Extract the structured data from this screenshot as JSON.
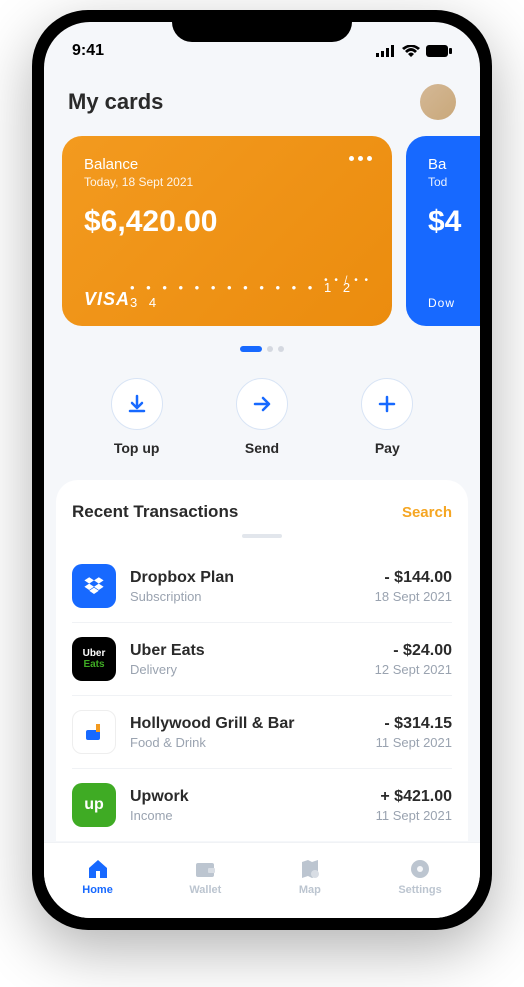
{
  "status": {
    "time": "9:41"
  },
  "header": {
    "title": "My cards"
  },
  "cards": [
    {
      "label": "Balance",
      "date": "Today, 18 Sept 2021",
      "balance": "$6,420.00",
      "brand": "VISA",
      "number": "• • • •   • • • •   • • • •   1 2 3 4",
      "expiry": "• • / • •"
    },
    {
      "label": "Ba",
      "date": "Tod",
      "balance": "$4",
      "brand": "Dow",
      "number": "",
      "expiry": ""
    }
  ],
  "actions": [
    {
      "label": "Top up",
      "icon": "download"
    },
    {
      "label": "Send",
      "icon": "arrow-right"
    },
    {
      "label": "Pay",
      "icon": "plus"
    }
  ],
  "transactions": {
    "title": "Recent Transactions",
    "search_label": "Search",
    "items": [
      {
        "name": "Dropbox Plan",
        "category": "Subscription",
        "amount": "- $144.00",
        "date": "18 Sept 2021",
        "icon_bg": "#1769ff",
        "icon": "dropbox"
      },
      {
        "name": "Uber Eats",
        "category": "Delivery",
        "amount": "- $24.00",
        "date": "12 Sept 2021",
        "icon_bg": "#000",
        "icon": "uber"
      },
      {
        "name": "Hollywood Grill & Bar",
        "category": "Food & Drink",
        "amount": "- $314.15",
        "date": "11 Sept 2021",
        "icon_bg": "#fff",
        "icon": "food"
      },
      {
        "name": "Upwork",
        "category": "Income",
        "amount": "+ $421.00",
        "date": "11 Sept 2021",
        "icon_bg": "#3fab24",
        "icon": "upwork"
      }
    ]
  },
  "nav": [
    {
      "label": "Home",
      "icon": "home",
      "active": true
    },
    {
      "label": "Wallet",
      "icon": "wallet",
      "active": false
    },
    {
      "label": "Map",
      "icon": "map",
      "active": false
    },
    {
      "label": "Settings",
      "icon": "settings",
      "active": false
    }
  ]
}
